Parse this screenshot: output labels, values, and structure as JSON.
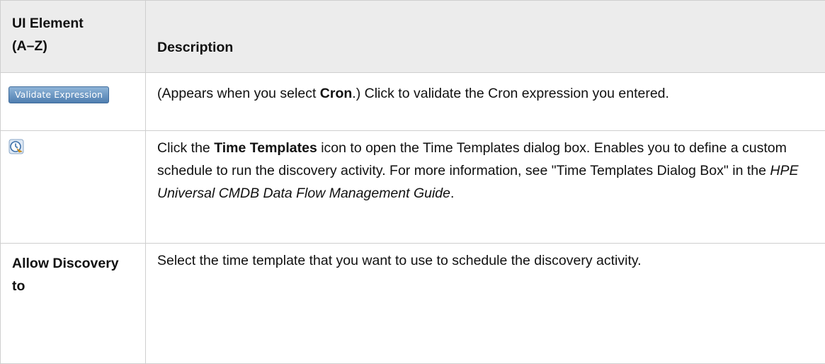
{
  "header": {
    "col1_line1": "UI Element",
    "col1_line2": "(A–Z)",
    "col2": "Description"
  },
  "rows": [
    {
      "element_button_label": "Validate Expression",
      "desc_pre": "(Appears when you select ",
      "desc_bold": "Cron",
      "desc_post": ".) Click to validate the Cron expression you entered."
    },
    {
      "element_icon": "time-templates-icon",
      "desc_pre": "Click the ",
      "desc_bold": "Time Templates",
      "desc_mid": " icon to open the Time Templates dialog box. Enables you to define a custom schedule to run the discovery activity. For more information, see \"Time Templates Dialog Box\" in the ",
      "desc_italic": "HPE Universal CMDB Data Flow Management Guide",
      "desc_post": "."
    },
    {
      "element_label": "Allow Discovery to",
      "desc": "Select the time template that you want to use to schedule the discovery activity."
    }
  ],
  "colors": {
    "header_bg": "#ececec",
    "border": "#cfcfcf",
    "button_top": "#8eb4d8",
    "button_bottom": "#4f7eb0"
  }
}
